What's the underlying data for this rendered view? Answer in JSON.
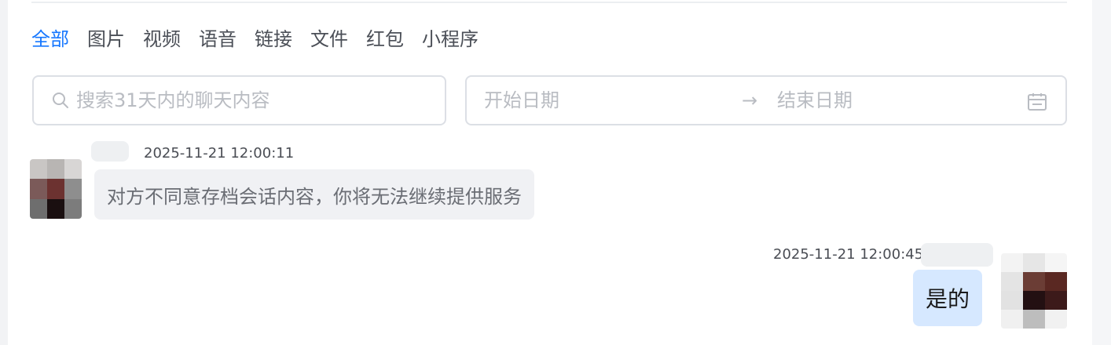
{
  "filter_tabs": [
    {
      "label": "全部",
      "active": true
    },
    {
      "label": "图片",
      "active": false
    },
    {
      "label": "视频",
      "active": false
    },
    {
      "label": "语音",
      "active": false
    },
    {
      "label": "链接",
      "active": false
    },
    {
      "label": "文件",
      "active": false
    },
    {
      "label": "红包",
      "active": false
    },
    {
      "label": "小程序",
      "active": false
    }
  ],
  "search": {
    "placeholder": "搜索31天内的聊天内容",
    "value": "",
    "icon": "search-icon"
  },
  "date_range": {
    "start_placeholder": "开始日期",
    "end_placeholder": "结束日期",
    "separator": "→",
    "icon": "calendar-icon"
  },
  "messages": [
    {
      "side": "left",
      "timestamp": "2025-11-21 12:00:11",
      "text": "对方不同意存档会话内容，你将无法继续提供服务",
      "avatar_colors": [
        "#c9c6c4",
        "#b8b5b3",
        "#d8d6d5",
        "#7b5a59",
        "#6c3230",
        "#8e8e8e",
        "#6e6e6e",
        "#1a0f10",
        "#7c7c7c"
      ]
    },
    {
      "side": "right",
      "timestamp": "2025-11-21 12:00:45",
      "text": "是的",
      "avatar_colors": [
        "#f3f3f3",
        "#e6e6e6",
        "#f5f5f5",
        "#e4e4e4",
        "#6b3d35",
        "#5a2822",
        "#e2e2e2",
        "#231012",
        "#3c1a1a",
        "#f0f0f0",
        "#bdbdbd",
        "#f1f1f1"
      ]
    }
  ],
  "colors": {
    "accent": "#1677ff",
    "bubble_left": "#f0f1f4",
    "bubble_right": "#d6e8ff"
  }
}
